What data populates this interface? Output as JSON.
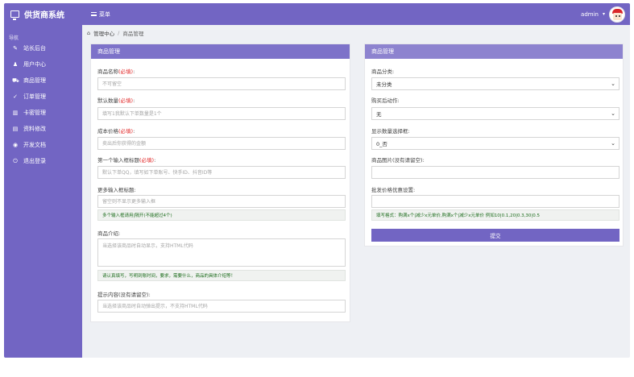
{
  "header": {
    "brand": "供货商系统",
    "menu_label": "菜单",
    "username": "admin",
    "caret": "▾"
  },
  "sidebar": {
    "heading": "导航",
    "items": [
      {
        "label": "站长后台",
        "icon": "wrench-icon",
        "glyph": "✎"
      },
      {
        "label": "用户中心",
        "icon": "user-icon",
        "glyph": "♟"
      },
      {
        "label": "商品管理",
        "icon": "cart-icon",
        "glyph": "⛟"
      },
      {
        "label": "订单管理",
        "icon": "chart-icon",
        "glyph": "✓"
      },
      {
        "label": "卡密管理",
        "icon": "grid-icon",
        "glyph": "▥"
      },
      {
        "label": "资料修改",
        "icon": "card-icon",
        "glyph": "▤"
      },
      {
        "label": "开发文档",
        "icon": "eye-icon",
        "glyph": "◉"
      },
      {
        "label": "退出登录",
        "icon": "power-icon",
        "glyph": "⏻"
      }
    ]
  },
  "breadcrumb": {
    "home": "管理中心",
    "sep": "/",
    "current": "商品管理"
  },
  "left_panel": {
    "title": "商品管理",
    "required_mark": "(必填)",
    "fields": {
      "name_label": "商品名称",
      "name_placeholder": "不可留空",
      "qty_label": "默认数量",
      "qty_placeholder": "填写1我默认下单数量是1个",
      "cost_label": "成本价格",
      "cost_placeholder": "卖出后你获得的金额",
      "first_input_label": "第一个输入框标题",
      "first_input_placeholder": "默认下单QQ，填写如下单账号、快手ID、抖音ID等",
      "more_input_label": "更多输入框标题:",
      "more_input_placeholder": "留空则不显示更多输入框",
      "more_input_help": "多个输入框请用|隔开(不能超过4个)",
      "intro_label": "商品介绍:",
      "intro_placeholder": "当选择该商品时自动显示，支持HTML代码",
      "intro_help": "请认真填写，写明到账时间，要求，需要什么，商品的具体介绍等！",
      "tips_label": "提示内容(没有请留空):",
      "tips_placeholder": "当选择该商品时自动弹出提示，不支持HTML代码"
    }
  },
  "right_panel": {
    "title": "商品管理",
    "category_label": "商品分类:",
    "category_value": "未分类",
    "action_label": "购买后动作:",
    "action_value": "无",
    "qty_select_label": "显示数量选择框:",
    "qty_select_value": "0_否",
    "image_label": "商品图片(没有请留空):",
    "discount_label": "批发价格优惠设置:",
    "discount_help": "填写格式：购满x个|减少x元单价,购满x个|减少x元单价  例如10|0.1,20|0.3,30|0.5",
    "submit_label": "提交",
    "chevron": "⌄"
  }
}
